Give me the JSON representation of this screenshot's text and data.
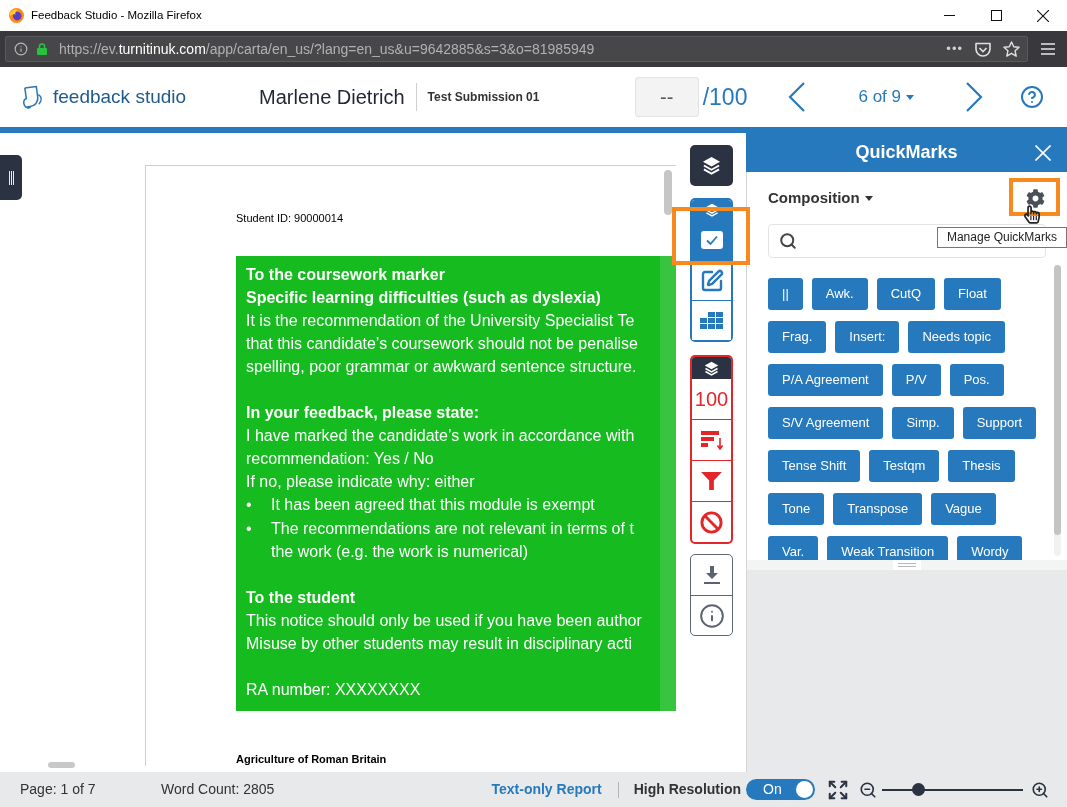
{
  "browser": {
    "title": "Feedback Studio - Mozilla Firefox",
    "url": {
      "scheme": "https://ev.",
      "domain": "turnitinuk.com",
      "path": "/app/carta/en_us/?lang=en_us&u=9642885&s=3&o=81985949"
    },
    "page_actions": "•••"
  },
  "header": {
    "logo": "feedback studio",
    "student": "Marlene Dietrich",
    "submission": "Test Submission 01",
    "score": "--",
    "score_max": "/100",
    "position": "6 of 9"
  },
  "document": {
    "student_id": "Student ID: 90000014",
    "notice": [
      {
        "lines": [
          {
            "kind": "heading",
            "text": "To the coursework marker"
          },
          {
            "kind": "heading",
            "text": "Specific learning difficulties (such as dyslexia)"
          },
          {
            "kind": "text",
            "text": "It is the recommendation of the University Specialist Te"
          },
          {
            "kind": "text",
            "text": "that this candidate’s coursework should not be penalise"
          },
          {
            "kind": "text",
            "text": "spelling, poor grammar or awkward sentence structure."
          }
        ]
      },
      {
        "lines": [
          {
            "kind": "heading",
            "text": "In your feedback, please state:"
          },
          {
            "kind": "text",
            "text": "I have marked the candidate’s work in accordance with"
          },
          {
            "kind": "text",
            "text": "recommendation: Yes / No"
          },
          {
            "kind": "text",
            "text": "If no, please indicate why: either"
          },
          {
            "kind": "bullet",
            "marker": "•",
            "lines": [
              "It has been agreed that this module is exempt"
            ]
          },
          {
            "kind": "bullet",
            "marker": "•",
            "lines": [
              "The recommendations are not relevant in terms of t",
              "the work (e.g. the work is numerical)"
            ]
          }
        ]
      },
      {
        "lines": [
          {
            "kind": "heading",
            "text": "To the student"
          },
          {
            "kind": "text",
            "text": "This notice should only be used if you have been author"
          },
          {
            "kind": "text",
            "text": "Misuse by other students may result in disciplinary acti"
          }
        ]
      },
      {
        "lines": [
          {
            "kind": "text",
            "text": "RA number: XXXXXXXX"
          }
        ]
      }
    ],
    "heading": "Agriculture of Roman Britain"
  },
  "tools": {
    "grading": [
      {
        "selected": true,
        "highlighted": true
      },
      {
        "selected": false,
        "highlighted": false
      },
      {
        "selected": false,
        "highlighted": false
      }
    ],
    "similarity_score": "100"
  },
  "quickmarks": {
    "title": "QuickMarks",
    "set": "Composition",
    "settings_highlighted": true,
    "tooltip": "Manage QuickMarks",
    "marks": [
      "||",
      "Awk.",
      "CutQ",
      "Float",
      "Frag.",
      "Insert:",
      "Needs topic",
      "P/A Agreement",
      "P/V",
      "Pos.",
      "S/V Agreement",
      "Simp.",
      "Support",
      "Tense Shift",
      "Testqm",
      "Thesis",
      "Tone",
      "Transpose",
      "Vague",
      "Var.",
      "Weak Transition",
      "Wordy"
    ]
  },
  "status_bar": {
    "page": "Page: 1 of 7",
    "word_count": "Word Count: 2805",
    "report_link": "Text-only Report",
    "high_resolution": {
      "label": "High Resolution",
      "on": true,
      "state": "On"
    },
    "zoom": {
      "level": 0.26
    }
  }
}
